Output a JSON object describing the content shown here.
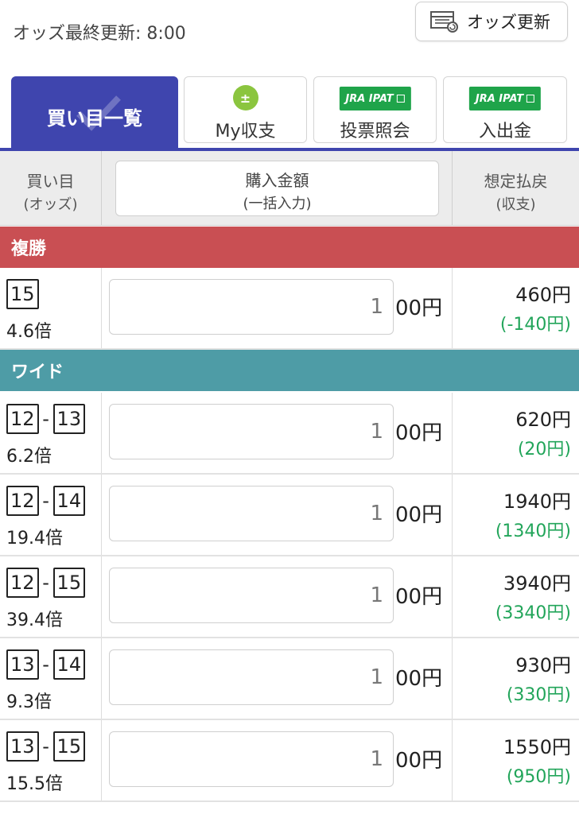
{
  "topbar": {
    "update_text": "オッズ最終更新: 8:00",
    "refresh_label": "オッズ更新"
  },
  "tabs": [
    {
      "label": "買い目一覧",
      "active": true
    },
    {
      "label": "My収支",
      "icon": "plus-minus-icon"
    },
    {
      "label": "投票照会",
      "badge": "JRA IPAT"
    },
    {
      "label": "入出金",
      "badge": "JRA IPAT"
    }
  ],
  "header": {
    "col1_main": "買い目",
    "col1_sub": "(オッズ)",
    "col2_main": "購入金額",
    "col2_sub": "(一括入力)",
    "col3_main": "想定払戻",
    "col3_sub": "(収支)"
  },
  "colors": {
    "accent": "#3f45ae",
    "fukusho": "#c94f53",
    "wide": "#4e9ca6",
    "profit": "#22a55a",
    "jra": "#1fa44a",
    "my_icon": "#8bc53f"
  },
  "sections": [
    {
      "title": "複勝",
      "bets": [
        {
          "nums": [
            "15"
          ],
          "odds": "4.6倍",
          "amount_value": "1",
          "amount_suffix": "00円",
          "payout": "460円",
          "profit": "(-140円)"
        }
      ]
    },
    {
      "title": "ワイド",
      "bets": [
        {
          "nums": [
            "12",
            "13"
          ],
          "odds": "6.2倍",
          "amount_value": "1",
          "amount_suffix": "00円",
          "payout": "620円",
          "profit": "(20円)"
        },
        {
          "nums": [
            "12",
            "14"
          ],
          "odds": "19.4倍",
          "amount_value": "1",
          "amount_suffix": "00円",
          "payout": "1940円",
          "profit": "(1340円)"
        },
        {
          "nums": [
            "12",
            "15"
          ],
          "odds": "39.4倍",
          "amount_value": "1",
          "amount_suffix": "00円",
          "payout": "3940円",
          "profit": "(3340円)"
        },
        {
          "nums": [
            "13",
            "14"
          ],
          "odds": "9.3倍",
          "amount_value": "1",
          "amount_suffix": "00円",
          "payout": "930円",
          "profit": "(330円)"
        },
        {
          "nums": [
            "13",
            "15"
          ],
          "odds": "15.5倍",
          "amount_value": "1",
          "amount_suffix": "00円",
          "payout": "1550円",
          "profit": "(950円)"
        }
      ]
    }
  ]
}
